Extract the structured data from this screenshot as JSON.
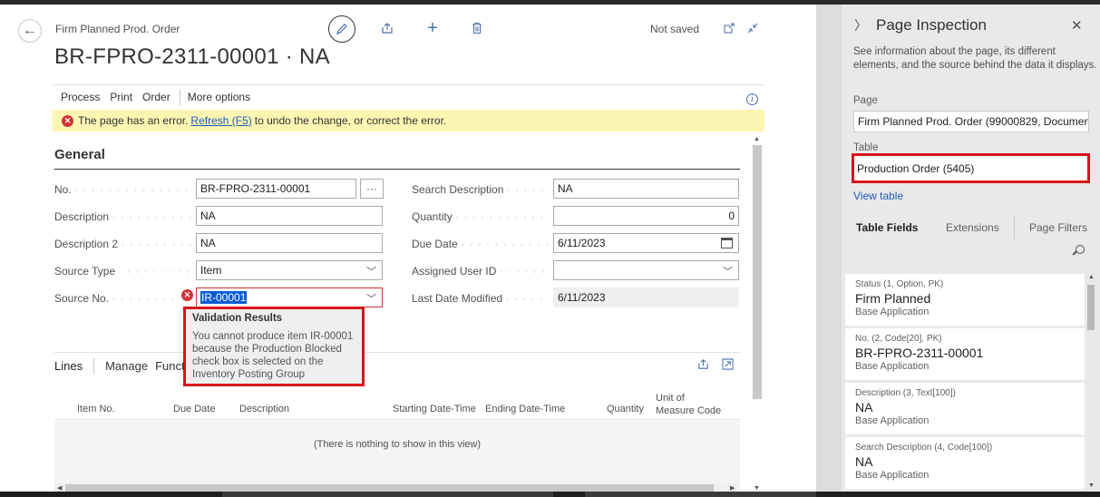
{
  "page": {
    "caption": "Firm Planned Prod. Order",
    "title": "BR-FPRO-2311-00001 · NA",
    "status": "Not saved",
    "actions": [
      "Process",
      "Print",
      "Order"
    ],
    "more_options": "More options"
  },
  "error_bar": {
    "text_before": "The page has an error.",
    "link": "Refresh (F5)",
    "text_after": "to undo the change, or correct the error."
  },
  "general": {
    "title": "General",
    "no": {
      "label": "No.",
      "value": "BR-FPRO-2311-00001"
    },
    "description": {
      "label": "Description",
      "value": "NA"
    },
    "description2": {
      "label": "Description 2",
      "value": "NA"
    },
    "source_type": {
      "label": "Source Type",
      "value": "Item"
    },
    "source_no": {
      "label": "Source No.",
      "value": "IR-00001"
    },
    "search_description": {
      "label": "Search Description",
      "value": "NA"
    },
    "quantity": {
      "label": "Quantity",
      "value": "0"
    },
    "due_date": {
      "label": "Due Date",
      "value": "6/11/2023"
    },
    "assigned_user": {
      "label": "Assigned User ID",
      "value": ""
    },
    "last_modified": {
      "label": "Last Date Modified",
      "value": "6/11/2023"
    }
  },
  "validation": {
    "title": "Validation Results",
    "message": "You cannot produce item IR-00001 because the Production Blocked check box is selected on the Inventory Posting Group"
  },
  "lines": {
    "title": "Lines",
    "manage": "Manage",
    "functions": "Funct",
    "columns": [
      "Item No.",
      "Due Date",
      "Description",
      "Starting Date-Time",
      "Ending Date-Time",
      "Quantity",
      "Unit of",
      "Measure Code"
    ],
    "empty": "(There is nothing to show in this view)"
  },
  "inspection": {
    "title": "Page Inspection",
    "description": "See information about the page, its different elements, and the source behind the data it displays.",
    "page_label": "Page",
    "page_value": "Firm Planned Prod. Order (99000829, Document)",
    "table_label": "Table",
    "table_value": "Production Order (5405)",
    "view_table": "View table",
    "tabs": [
      "Table Fields",
      "Extensions",
      "Page Filters"
    ],
    "fields": [
      {
        "key": "Status (1, Option, PK)",
        "value": "Firm Planned",
        "source": "Base Application"
      },
      {
        "key": "No. (2, Code[20], PK)",
        "value": "BR-FPRO-2311-00001",
        "source": "Base Application"
      },
      {
        "key": "Description (3, Text[100])",
        "value": "NA",
        "source": "Base Application"
      },
      {
        "key": "Search Description (4, Code[100])",
        "value": "NA",
        "source": "Base Application"
      }
    ]
  },
  "icons": [
    "back-arrow-icon",
    "edit-pencil-icon",
    "share-icon",
    "add-icon",
    "delete-icon",
    "open-new-window-icon",
    "collapse-icon",
    "info-icon",
    "error-icon",
    "calendar-icon",
    "chevron-down-icon",
    "search-icon",
    "close-icon"
  ],
  "colors": {
    "error": "#d13438",
    "highlight": "#d8121a",
    "warning_bg": "#fdf6b3",
    "link": "#1f5ab8",
    "accent": "#4d6fa9"
  }
}
